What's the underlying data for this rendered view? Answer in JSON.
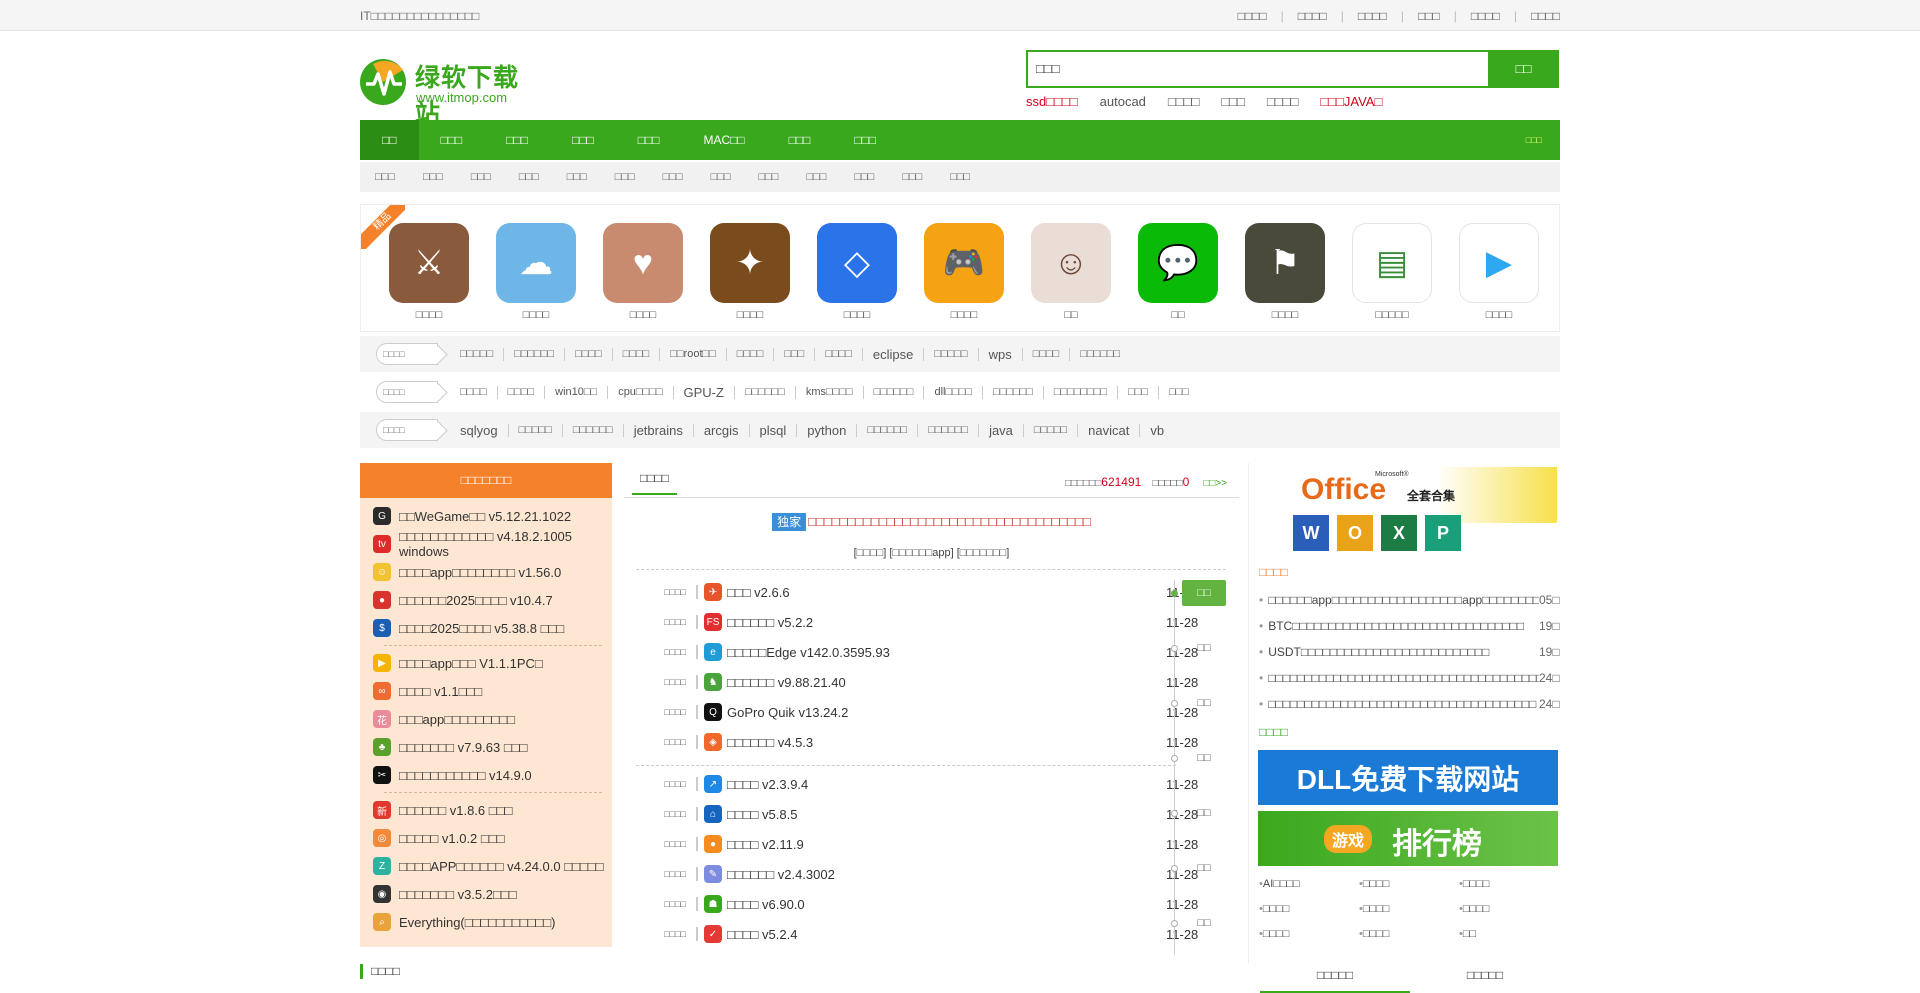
{
  "topbar": {
    "left": "IT□□□□□□□□□□□□□□□",
    "links": [
      "□□□□",
      "□□□□",
      "□□□□",
      "□□□",
      "□□□□",
      "□□□□"
    ]
  },
  "logo": {
    "name": "绿软下载站",
    "url": "www.itmop.com"
  },
  "search": {
    "value": "□□□",
    "button": "□□"
  },
  "hotkeys": [
    {
      "t": "ssd□□□□",
      "red": true
    },
    {
      "t": "autocad",
      "red": false
    },
    {
      "t": "□□□□",
      "red": false
    },
    {
      "t": "□□□",
      "red": false
    },
    {
      "t": "□□□□",
      "red": false
    },
    {
      "t": "□□□JAVA□",
      "red": true
    }
  ],
  "nav": {
    "items": [
      "□□",
      "□□□",
      "□□□",
      "□□□",
      "□□□",
      "MAC□□",
      "□□□",
      "□□□"
    ],
    "right": "□□□"
  },
  "subnav": [
    "□□□",
    "□□□",
    "□□□",
    "□□□",
    "□□□",
    "□□□",
    "□□□",
    "□□□",
    "□□□",
    "□□□",
    "□□□",
    "□□□",
    "□□□"
  ],
  "featured": {
    "ribbon": "精品",
    "apps": [
      {
        "name": "□□□□",
        "icon": "warrior-icon",
        "color": "#8a5a3c"
      },
      {
        "name": "□□□□",
        "icon": "cartoon-icon",
        "color": "#6fb6e8"
      },
      {
        "name": "□□□□",
        "icon": "couple-icon",
        "color": "#c98b70"
      },
      {
        "name": "□□□□",
        "icon": "hearthstone-icon",
        "color": "#7a4b1c"
      },
      {
        "name": "□□□□",
        "icon": "cube-icon",
        "color": "#2a73e8"
      },
      {
        "name": "□□□□",
        "icon": "gamepad-icon",
        "color": "#f6a313"
      },
      {
        "name": "□□",
        "icon": "girl-avatar-icon",
        "color": "#e9ddd6"
      },
      {
        "name": "□□",
        "icon": "wechat-icon",
        "color": "#09bb07"
      },
      {
        "name": "□□□□",
        "icon": "pubg-icon",
        "color": "#4a4a3a"
      },
      {
        "name": "□□□□□",
        "icon": "bluestacks-icon",
        "color": "#ffffff"
      },
      {
        "name": "□□□□",
        "icon": "tencent-video-icon",
        "color": "#ffffff"
      }
    ]
  },
  "tagrows": [
    {
      "box": "□□□□",
      "tags": [
        "□□□□□",
        "□□□□□□",
        "□□□□",
        "□□□□",
        "□□root□□",
        "□□□□",
        "□□□",
        "□□□□",
        "eclipse",
        "□□□□□",
        "wps",
        "□□□□",
        "□□□□□□"
      ]
    },
    {
      "box": "□□□□",
      "tags": [
        "□□□□",
        "□□□□",
        "win10□□",
        "cpu□□□□",
        "GPU-Z",
        "□□□□□□",
        "kms□□□□",
        "□□□□□□",
        "dll□□□□",
        "□□□□□□",
        "□□□□□□□□",
        "□□□",
        "□□□"
      ]
    },
    {
      "box": "□□□□",
      "tags": [
        "sqlyog",
        "□□□□□",
        "□□□□□□",
        "jetbrains",
        "arcgis",
        "plsql",
        "python",
        "□□□□□□",
        "□□□□□□",
        "java",
        "□□□□□",
        "navicat",
        "vb"
      ]
    }
  ],
  "left": {
    "title": "□□□□□□□",
    "groups": [
      [
        {
          "t": "□□WeGame□□ v5.12.21.1022",
          "c": "#2b2b2b",
          "g": "G"
        },
        {
          "t": "□□□□□□□□□□□□ v4.18.2.1005 windows",
          "c": "#e02a2a",
          "g": "tv"
        },
        {
          "t": "□□□□app□□□□□□□□ v1.56.0",
          "c": "#f2c230",
          "g": "☺"
        },
        {
          "t": "□□□□□□2025□□□□ v10.4.7",
          "c": "#d8332d",
          "g": "●"
        },
        {
          "t": "□□□□2025□□□□ v5.38.8 □□□",
          "c": "#1a5fb4",
          "g": "$"
        }
      ],
      [
        {
          "t": "□□□□app□□□ V1.1.1PC□",
          "c": "#f4b400",
          "g": "▶"
        },
        {
          "t": "□□□□ v1.1□□□",
          "c": "#f06b32",
          "g": "∞"
        },
        {
          "t": "□□□app□□□□□□□□□",
          "c": "#e88b9a",
          "g": "花"
        },
        {
          "t": "□□□□□□□ v7.9.63 □□□",
          "c": "#5aa02c",
          "g": "♣"
        },
        {
          "t": "□□□□□□□□□□□ v14.9.0",
          "c": "#111111",
          "g": "✂"
        }
      ],
      [
        {
          "t": "□□□□□□ v1.8.6 □□□",
          "c": "#e03a2e",
          "g": "新"
        },
        {
          "t": "□□□□□ v1.0.2 □□□",
          "c": "#f08a3a",
          "g": "◎"
        },
        {
          "t": "□□□□APP□□□□□□ v4.24.0.0 □□□□□",
          "c": "#2bb3a0",
          "g": "Z"
        },
        {
          "t": "□□□□□□□ v3.5.2□□□",
          "c": "#333333",
          "g": "◉"
        },
        {
          "t": "Everything(□□□□□□□□□□□)",
          "c": "#e8a43a",
          "g": "⌕"
        }
      ]
    ]
  },
  "center": {
    "tab": "□□□□",
    "total_label": "□□□□□□",
    "total": "621491",
    "today_label": "□□□□□",
    "today": "0",
    "more": "□□>>",
    "badge": "独家",
    "headline": "□□□□□□□□□□□□□□□□□□□□□□□□□□□□□□□□□□□□",
    "sublinks": "[□□□□] [□□□□□□app] [□□□□□□□]",
    "list1": [
      {
        "cat": "□□□□",
        "name": "□□□ v2.6.6",
        "date": "11-28",
        "c": "#e8552d",
        "g": "✈"
      },
      {
        "cat": "□□□□",
        "name": "□□□□□□ v5.2.2",
        "date": "11-28",
        "c": "#e22e2e",
        "g": "FS"
      },
      {
        "cat": "□□□□",
        "name": "□□□□□Edge v142.0.3595.93",
        "date": "11-28",
        "c": "#1f9bd7",
        "g": "e"
      },
      {
        "cat": "□□□□",
        "name": "□□□□□□ v9.88.21.40",
        "date": "11-28",
        "c": "#4aa43b",
        "g": "♞"
      },
      {
        "cat": "□□□□",
        "name": "GoPro Quik v13.24.2",
        "date": "11-28",
        "c": "#111111",
        "g": "Q"
      },
      {
        "cat": "□□□□",
        "name": "□□□□□□ v4.5.3",
        "date": "11-28",
        "c": "#f2672a",
        "g": "◈"
      }
    ],
    "list2": [
      {
        "cat": "□□□□",
        "name": "□□□□ v2.3.9.4",
        "date": "11-28",
        "c": "#1e88e5",
        "g": "↗"
      },
      {
        "cat": "□□□□",
        "name": "□□□□ v5.8.5",
        "date": "11-28",
        "c": "#1565c0",
        "g": "⌂"
      },
      {
        "cat": "□□□□",
        "name": "□□□□ v2.11.9",
        "date": "11-28",
        "c": "#f58a1f",
        "g": "●"
      },
      {
        "cat": "□□□□",
        "name": "□□□□□□ v2.4.3002",
        "date": "11-28",
        "c": "#7e8ce0",
        "g": "✎"
      },
      {
        "cat": "□□□□",
        "name": "□□□□ v6.90.0",
        "date": "11-28",
        "c": "#3aa81d",
        "g": "☗"
      },
      {
        "cat": "□□□□",
        "name": "□□□□ v5.2.4",
        "date": "11-28",
        "c": "#e53935",
        "g": "✓"
      }
    ],
    "timeline": [
      "□□",
      "□□",
      "□□",
      "□□",
      "□□",
      "□□",
      "□□"
    ]
  },
  "right": {
    "banner1": {
      "text": "Office",
      "sub": "全套合集",
      "brand": "Microsoft®"
    },
    "sec1": "□□□□",
    "news": [
      {
        "t": "□□□□□□app□□□□□□□□□□□□□□□□□□app□□□□□□□□",
        "d": "05□"
      },
      {
        "t": "BTC□□□□□□□□□□□□□□□□□□□□□□□□□□□□□□□□",
        "d": "19□"
      },
      {
        "t": "USDT□□□□□□□□□□□□□□□□□□□□□□□□□□",
        "d": "19□"
      },
      {
        "t": "□□□□□□□□□□□□□□□□□□□□□□□□□□□□□□□□□□□□□□",
        "d": "24□"
      },
      {
        "t": "□□□□□□□□□□□□□□□□□□□□□□□□□□□□□□□□□□□□□",
        "d": "24□"
      }
    ],
    "sec2": "□□□□",
    "banner2": "DLL免费下载网站",
    "banner3_tag": "游戏",
    "banner3": "排行榜",
    "grid": [
      "AI□□□□",
      "□□□□",
      "□□□□",
      "□□□□",
      "□□□□",
      "□□□□",
      "□□□□",
      "□□□□",
      "□□"
    ]
  },
  "bottom": {
    "title": "□□□□",
    "tabs": [
      "□□□□□",
      "□□□□□"
    ]
  },
  "colors": {
    "brand": "#3aa81d",
    "accent": "#f5822a"
  }
}
